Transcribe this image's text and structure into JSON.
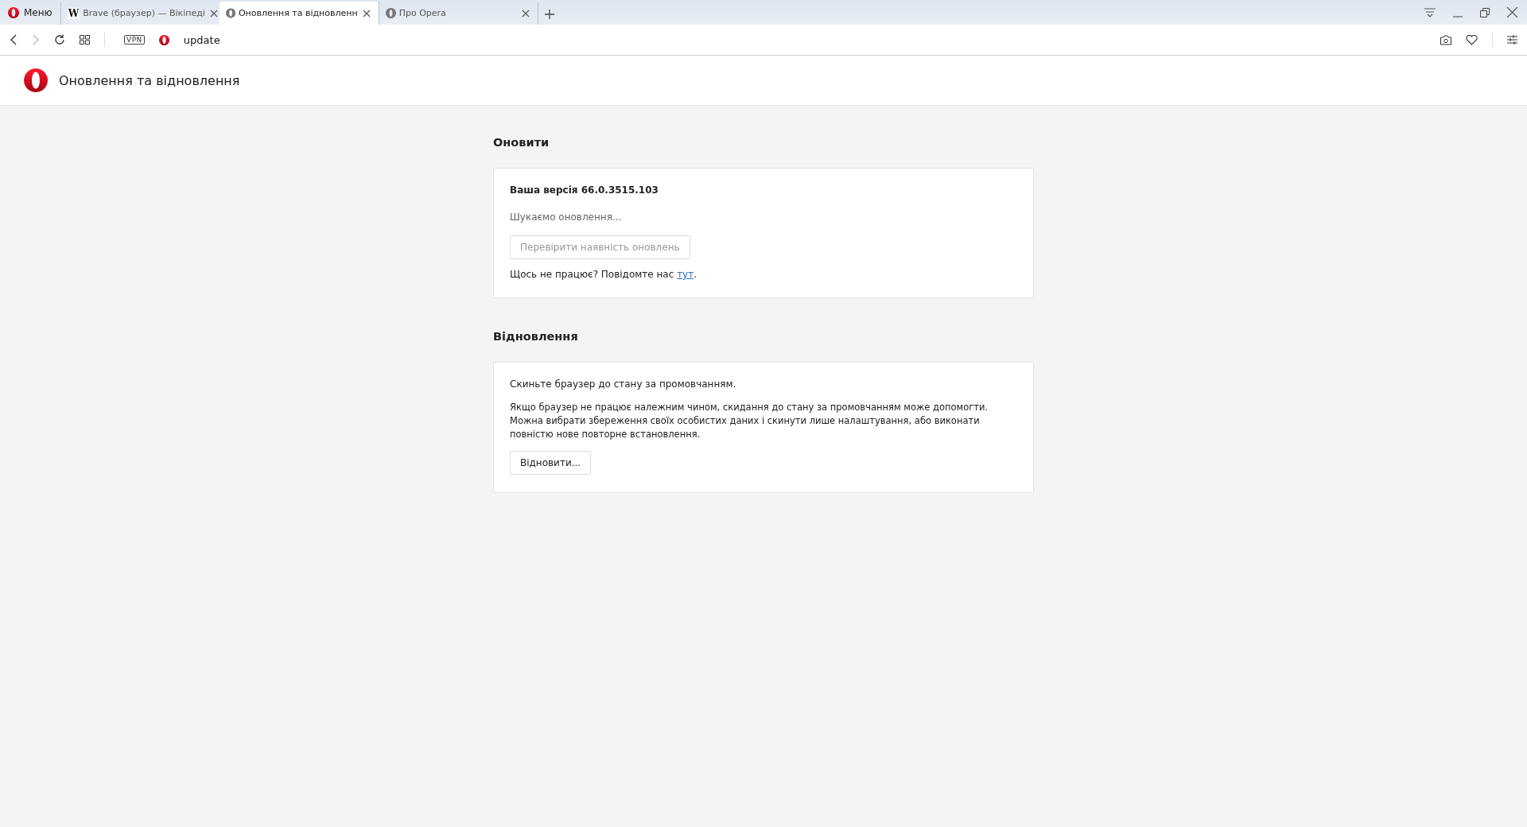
{
  "menu_button": {
    "label": "Меню"
  },
  "tabs": [
    {
      "kind": "wiki",
      "icon_label": "W",
      "title": "Brave (браузер) — Вікіпеді",
      "selected": false
    },
    {
      "kind": "opera",
      "title": "Оновлення та відновленн",
      "selected": true
    },
    {
      "kind": "opera",
      "title": "Про Opera",
      "selected": false
    }
  ],
  "address_bar": {
    "vpn_label": "VPN",
    "url": "update"
  },
  "page_header": {
    "title": "Оновлення та відновлення"
  },
  "update_section": {
    "heading": "Оновити",
    "version_label": "Ваша версія",
    "version": "66.0.3515.103",
    "status": "Шукаємо оновлення...",
    "check_button": {
      "label": "Перевірити наявність оновлень",
      "disabled": true
    },
    "report_text": "Щось не працює? Повідомте нас ",
    "report_link": "тут",
    "report_end": "."
  },
  "recovery_section": {
    "heading": "Відновлення",
    "intro": "Скиньте браузер до стану за промовчанням.",
    "description": "Якщо браузер не працює належним чином, скидання до стану за промовчанням може допомогти. Можна вибрати збереження своїх особистих даних і скинути лише налаштування, або виконати повністю нове повторне встановлення.",
    "recover_button": {
      "label": "Відновити...",
      "disabled": false
    }
  }
}
